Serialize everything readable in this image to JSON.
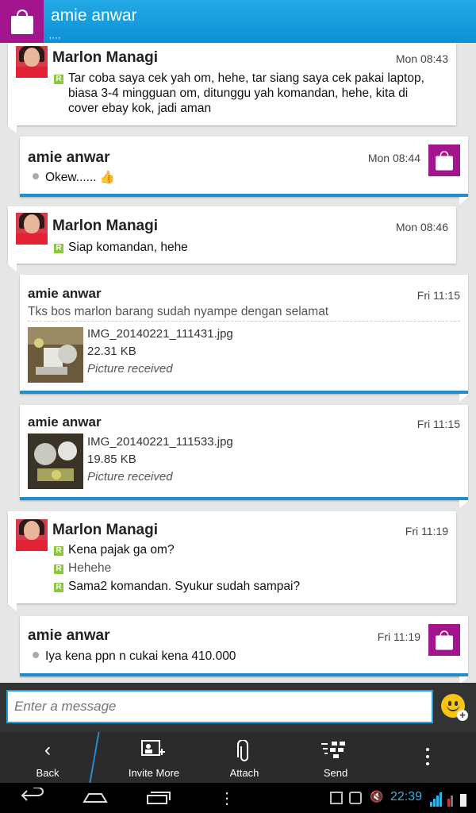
{
  "header": {
    "title": "amie anwar",
    "subtitle": ",,,,",
    "brand_color": "#a3158c"
  },
  "messages": [
    {
      "sender": "Marlon Managi",
      "time": "Mon 08:43",
      "lines": [
        "Tar coba saya cek yah om, hehe, tar siang saya cek pakai laptop,",
        "biasa 3-4 mingguan om, ditunggu yah komandan, hehe, kita di",
        "cover ebay kok, jadi aman"
      ]
    },
    {
      "sender": "amie anwar",
      "time": "Mon 08:44",
      "text": "Okew...... 👍"
    },
    {
      "sender": "Marlon Managi",
      "time": "Mon 08:46",
      "lines": [
        "Siap komandan, hehe"
      ]
    },
    {
      "sender": "amie anwar",
      "time": "Fri 11:15",
      "caption": "Tks bos marlon barang sudah nyampe dengan selamat",
      "file": {
        "name": "IMG_20140221_111431.jpg",
        "size": "22.31 KB",
        "status": "Picture received"
      }
    },
    {
      "sender": "amie anwar",
      "time": "Fri 11:15",
      "file": {
        "name": "IMG_20140221_111533.jpg",
        "size": "19.85 KB",
        "status": "Picture received"
      }
    },
    {
      "sender": "Marlon Managi",
      "time": "Fri 11:19",
      "lines": [
        "Kena pajak ga om?",
        "Hehehe",
        "Sama2 komandan. Syukur sudah sampai?"
      ]
    },
    {
      "sender": "amie anwar",
      "time": "Fri 11:19",
      "text": "Iya kena ppn n cukai kena 410.000"
    }
  ],
  "composer": {
    "placeholder": "Enter a message"
  },
  "actions": {
    "back": "Back",
    "invite": "Invite More",
    "attach": "Attach",
    "send": "Send"
  },
  "status": {
    "clock": "22:39"
  },
  "icons": {
    "emoticon": "smiley-icon",
    "back": "chevron-left-icon",
    "invite": "add-contact-icon",
    "attach": "paperclip-icon",
    "send": "bbm-send-icon"
  },
  "colors": {
    "header": "#1a9fe0",
    "accent": "#1d8fcf",
    "brand": "#a3158c",
    "badge": "#8dc63f"
  }
}
